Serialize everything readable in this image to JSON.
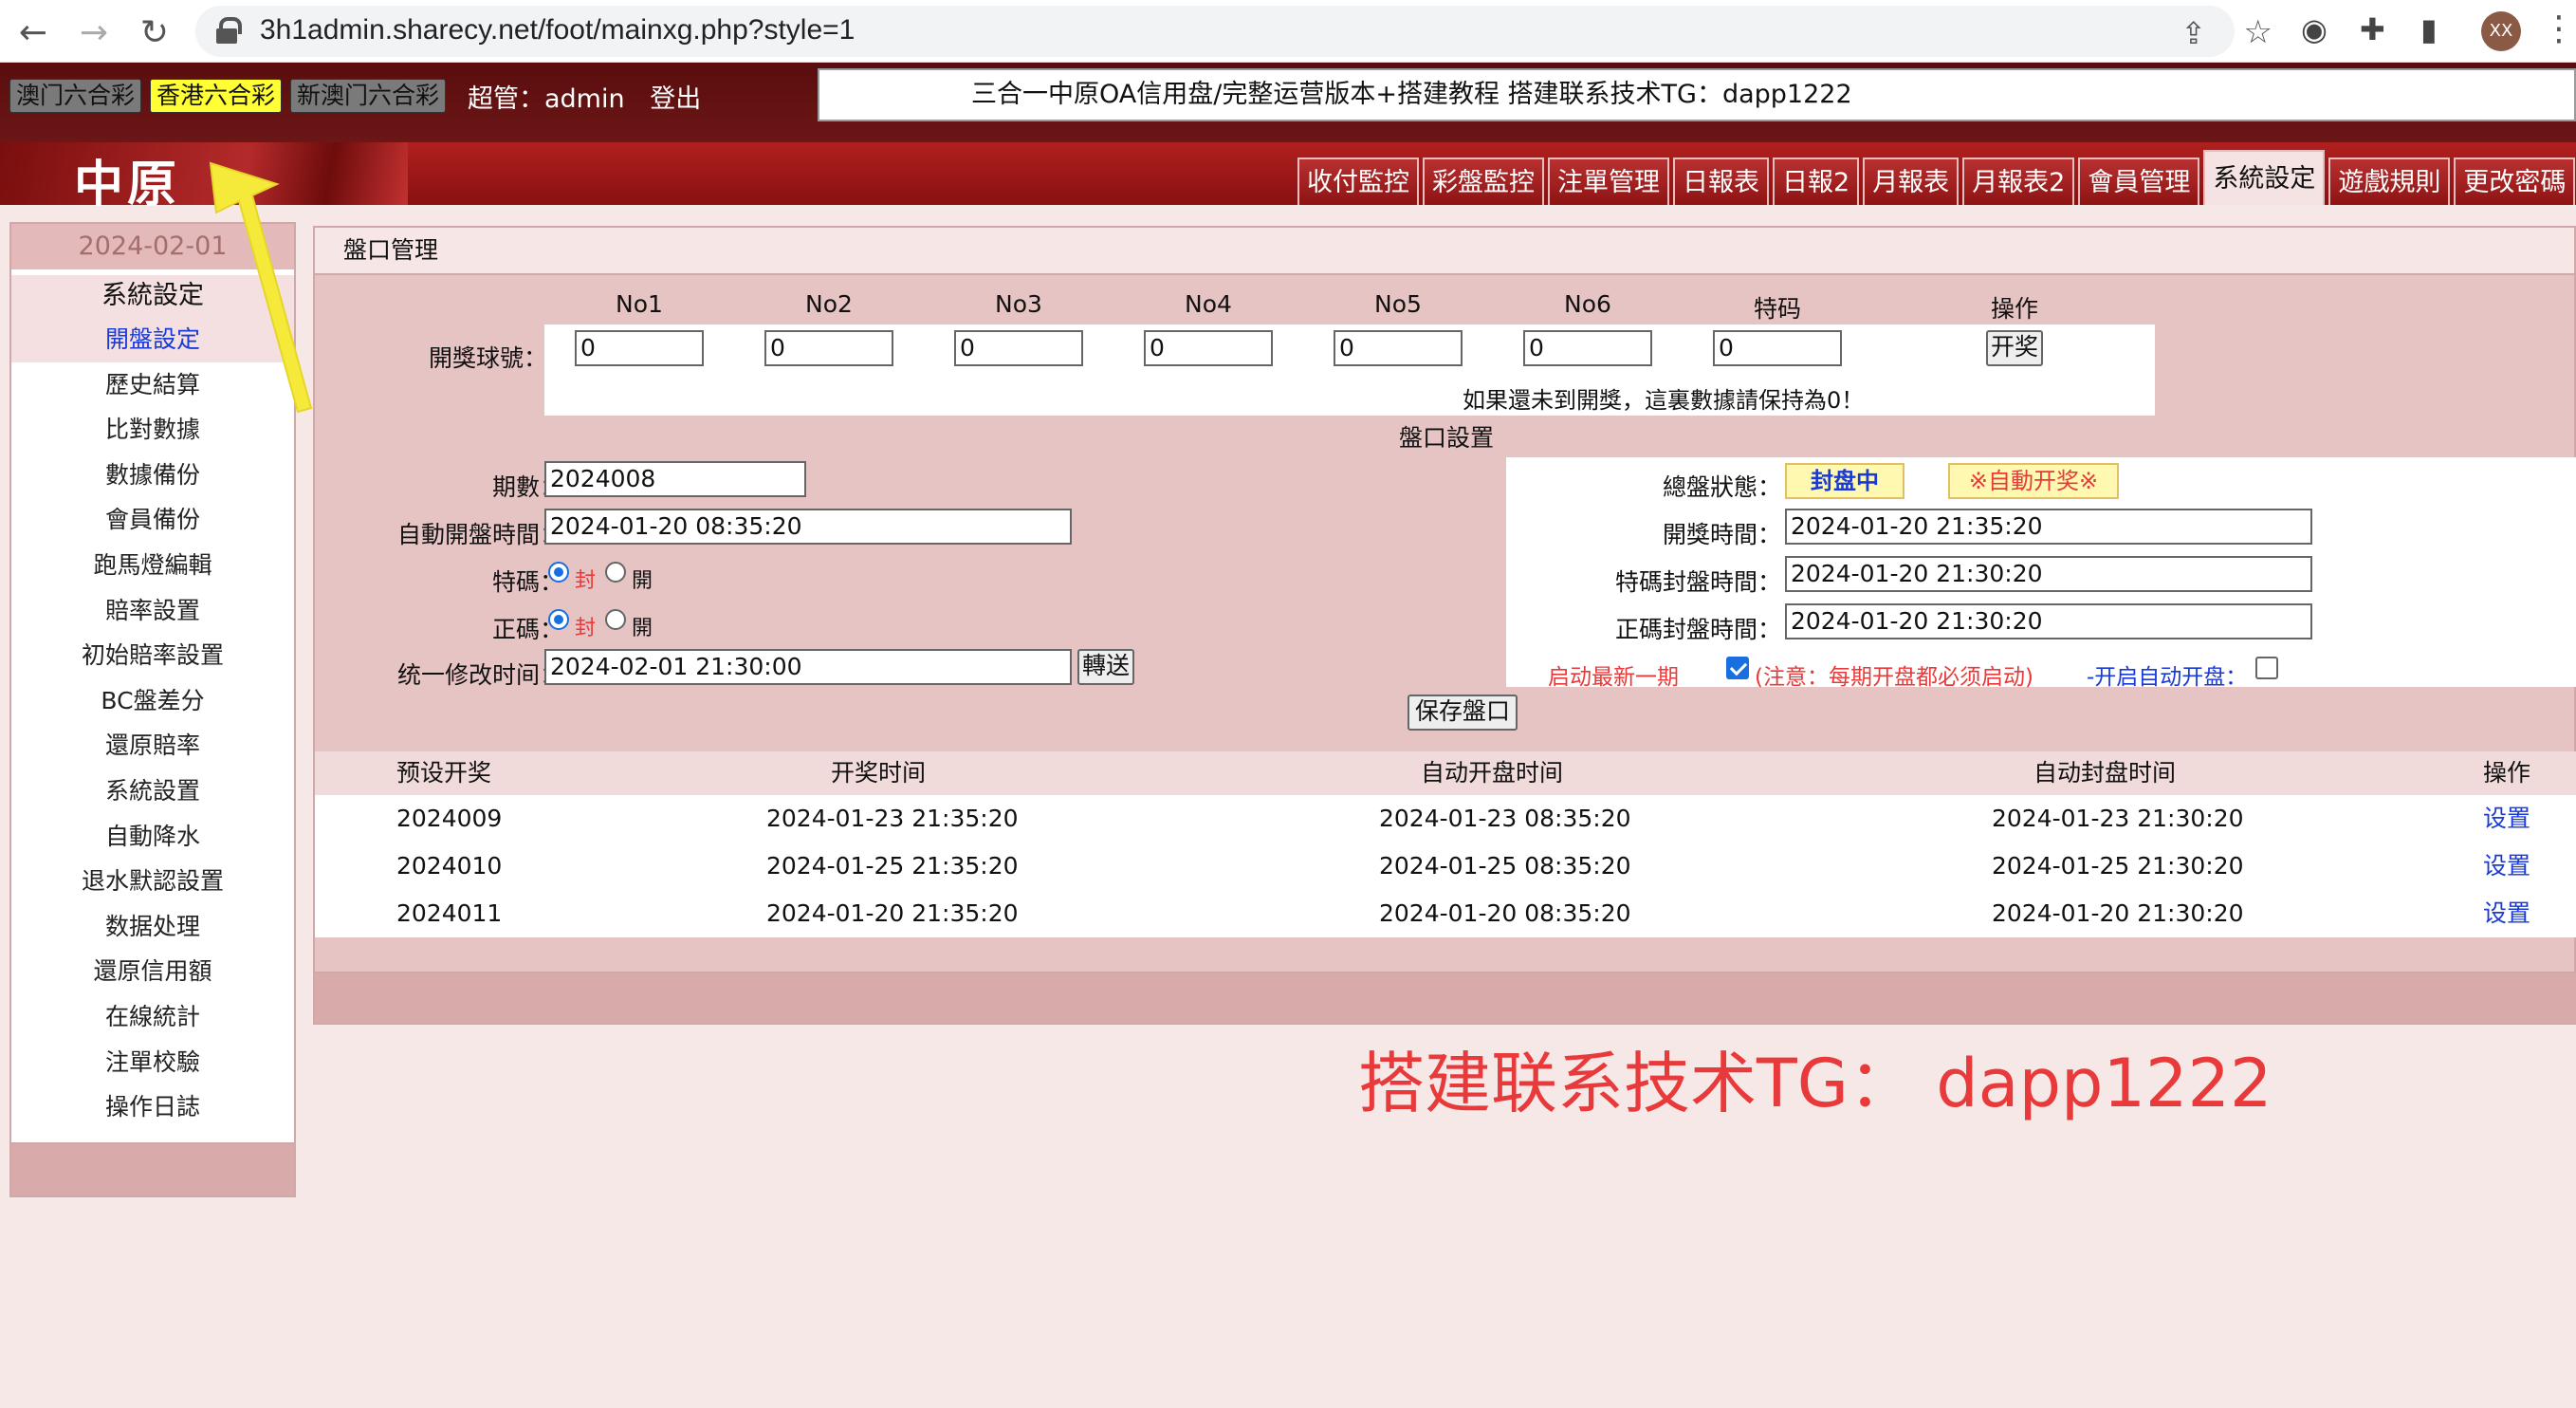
{
  "browser": {
    "url": "3h1admin.sharecy.net/foot/mainxg.php?style=1",
    "avatar": "XX"
  },
  "topbar": {
    "lotteries": [
      {
        "label": "澳门六合彩",
        "active": false
      },
      {
        "label": "香港六合彩",
        "active": true
      },
      {
        "label": "新澳门六合彩",
        "active": false
      }
    ],
    "user": "超管：admin",
    "logout": "登出",
    "marquee": "三合一中原OA信用盘/完整运营版本+搭建教程 搭建联系技术TG：dapp1222"
  },
  "logo": "中原",
  "tabs": [
    "收付監控",
    "彩盤監控",
    "注單管理",
    "日報表",
    "日報2",
    "月報表",
    "月報表2",
    "會員管理",
    "系統設定",
    "遊戲規則",
    "更改密碼"
  ],
  "active_tab": "系統設定",
  "sidebar": {
    "date": "2024-02-01",
    "title": "系統設定",
    "items": [
      "開盤設定",
      "歷史結算",
      "比對數據",
      "數據備份",
      "會員備份",
      "跑馬燈編輯",
      "賠率設置",
      "初始賠率設置",
      "BC盤差分",
      "還原賠率",
      "系統設置",
      "自動降水",
      "退水默認設置",
      "数据处理",
      "還原信用額",
      "在線統計",
      "注單校驗",
      "操作日誌"
    ],
    "active": "開盤設定"
  },
  "panel": {
    "title": "盤口管理",
    "draw": {
      "label": "開獎球號：",
      "columns": [
        "No1",
        "No2",
        "No3",
        "No4",
        "No5",
        "No6",
        "特码",
        "操作"
      ],
      "values": [
        "0",
        "0",
        "0",
        "0",
        "0",
        "0",
        "0"
      ],
      "draw_button": "开奖",
      "note": "如果還未到開獎，這裏數據請保持為0！"
    },
    "settings": {
      "title": "盤口設置",
      "period_label": "期數：",
      "period": "2024008",
      "auto_open_label": "自動開盤時間：",
      "auto_open": "2024-01-20 08:35:20",
      "tema_label": "特碼：",
      "zhengma_label": "正碼：",
      "opt_close": "封",
      "opt_open": "開",
      "unify_label": "统一修改时间：",
      "unify": "2024-02-01 21:30:00",
      "transfer_button": "轉送",
      "total_status_label": "總盤狀態：",
      "status_closed": "封盘中",
      "status_auto": "※自動开奖※",
      "draw_time_label": "開獎時間：",
      "draw_time": "2024-01-20 21:35:20",
      "tema_close_label": "特碼封盤時間：",
      "tema_close": "2024-01-20 21:30:20",
      "zhengma_close_label": "正碼封盤時間：",
      "zhengma_close": "2024-01-20 21:30:20",
      "start_new_label": "启动最新一期",
      "start_new_note": "(注意：每期开盘都必须启动)",
      "auto_open_switch_label": "-开启自动开盘：",
      "save_button": "保存盤口"
    },
    "schedule": {
      "headers": [
        "预设开奖",
        "开奖时间",
        "自动开盘时间",
        "自动封盘时间",
        "操作"
      ],
      "rows": [
        {
          "period": "2024009",
          "draw": "2024-01-23 21:35:20",
          "open": "2024-01-23 08:35:20",
          "close": "2024-01-23 21:30:20",
          "action": "设置"
        },
        {
          "period": "2024010",
          "draw": "2024-01-25 21:35:20",
          "open": "2024-01-25 08:35:20",
          "close": "2024-01-25 21:30:20",
          "action": "设置"
        },
        {
          "period": "2024011",
          "draw": "2024-01-20 21:35:20",
          "open": "2024-01-20 08:35:20",
          "close": "2024-01-20 21:30:20",
          "action": "设置"
        }
      ]
    }
  },
  "contact": "搭建联系技术TG： dapp1222"
}
